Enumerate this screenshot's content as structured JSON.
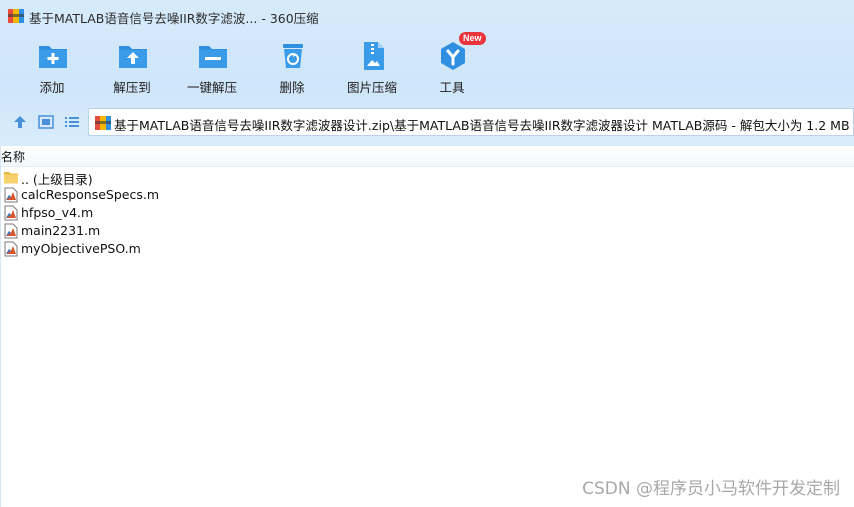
{
  "window": {
    "title": "基于MATLAB语音信号去噪IIR数字滤波... - 360压缩"
  },
  "toolbar": {
    "items": [
      {
        "label": "添加",
        "icon": "add-folder-icon"
      },
      {
        "label": "解压到",
        "icon": "extract-to-icon"
      },
      {
        "label": "一键解压",
        "icon": "one-click-extract-icon"
      },
      {
        "label": "删除",
        "icon": "delete-icon"
      },
      {
        "label": "图片压缩",
        "icon": "image-compress-icon"
      },
      {
        "label": "工具",
        "icon": "tools-icon",
        "badge": "New"
      }
    ]
  },
  "address": {
    "path": "基于MATLAB语音信号去噪IIR数字滤波器设计.zip\\基于MATLAB语音信号去噪IIR数字滤波器设计 MATLAB源码 - 解包大小为 1.2 MB"
  },
  "list": {
    "column_name": "名称",
    "rows": [
      {
        "name": ".. (上级目录)",
        "icon": "folder-icon"
      },
      {
        "name": "calcResponseSpecs.m",
        "icon": "matlab-file-icon"
      },
      {
        "name": "hfpso_v4.m",
        "icon": "matlab-file-icon"
      },
      {
        "name": "main2231.m",
        "icon": "matlab-file-icon"
      },
      {
        "name": "myObjectivePSO.m",
        "icon": "matlab-file-icon"
      }
    ]
  },
  "watermark": "CSDN @程序员小马软件开发定制",
  "colors": {
    "accent": "#2f8fe0",
    "badge": "#e8343a",
    "toolbar_bg": "#d6ebfb"
  }
}
